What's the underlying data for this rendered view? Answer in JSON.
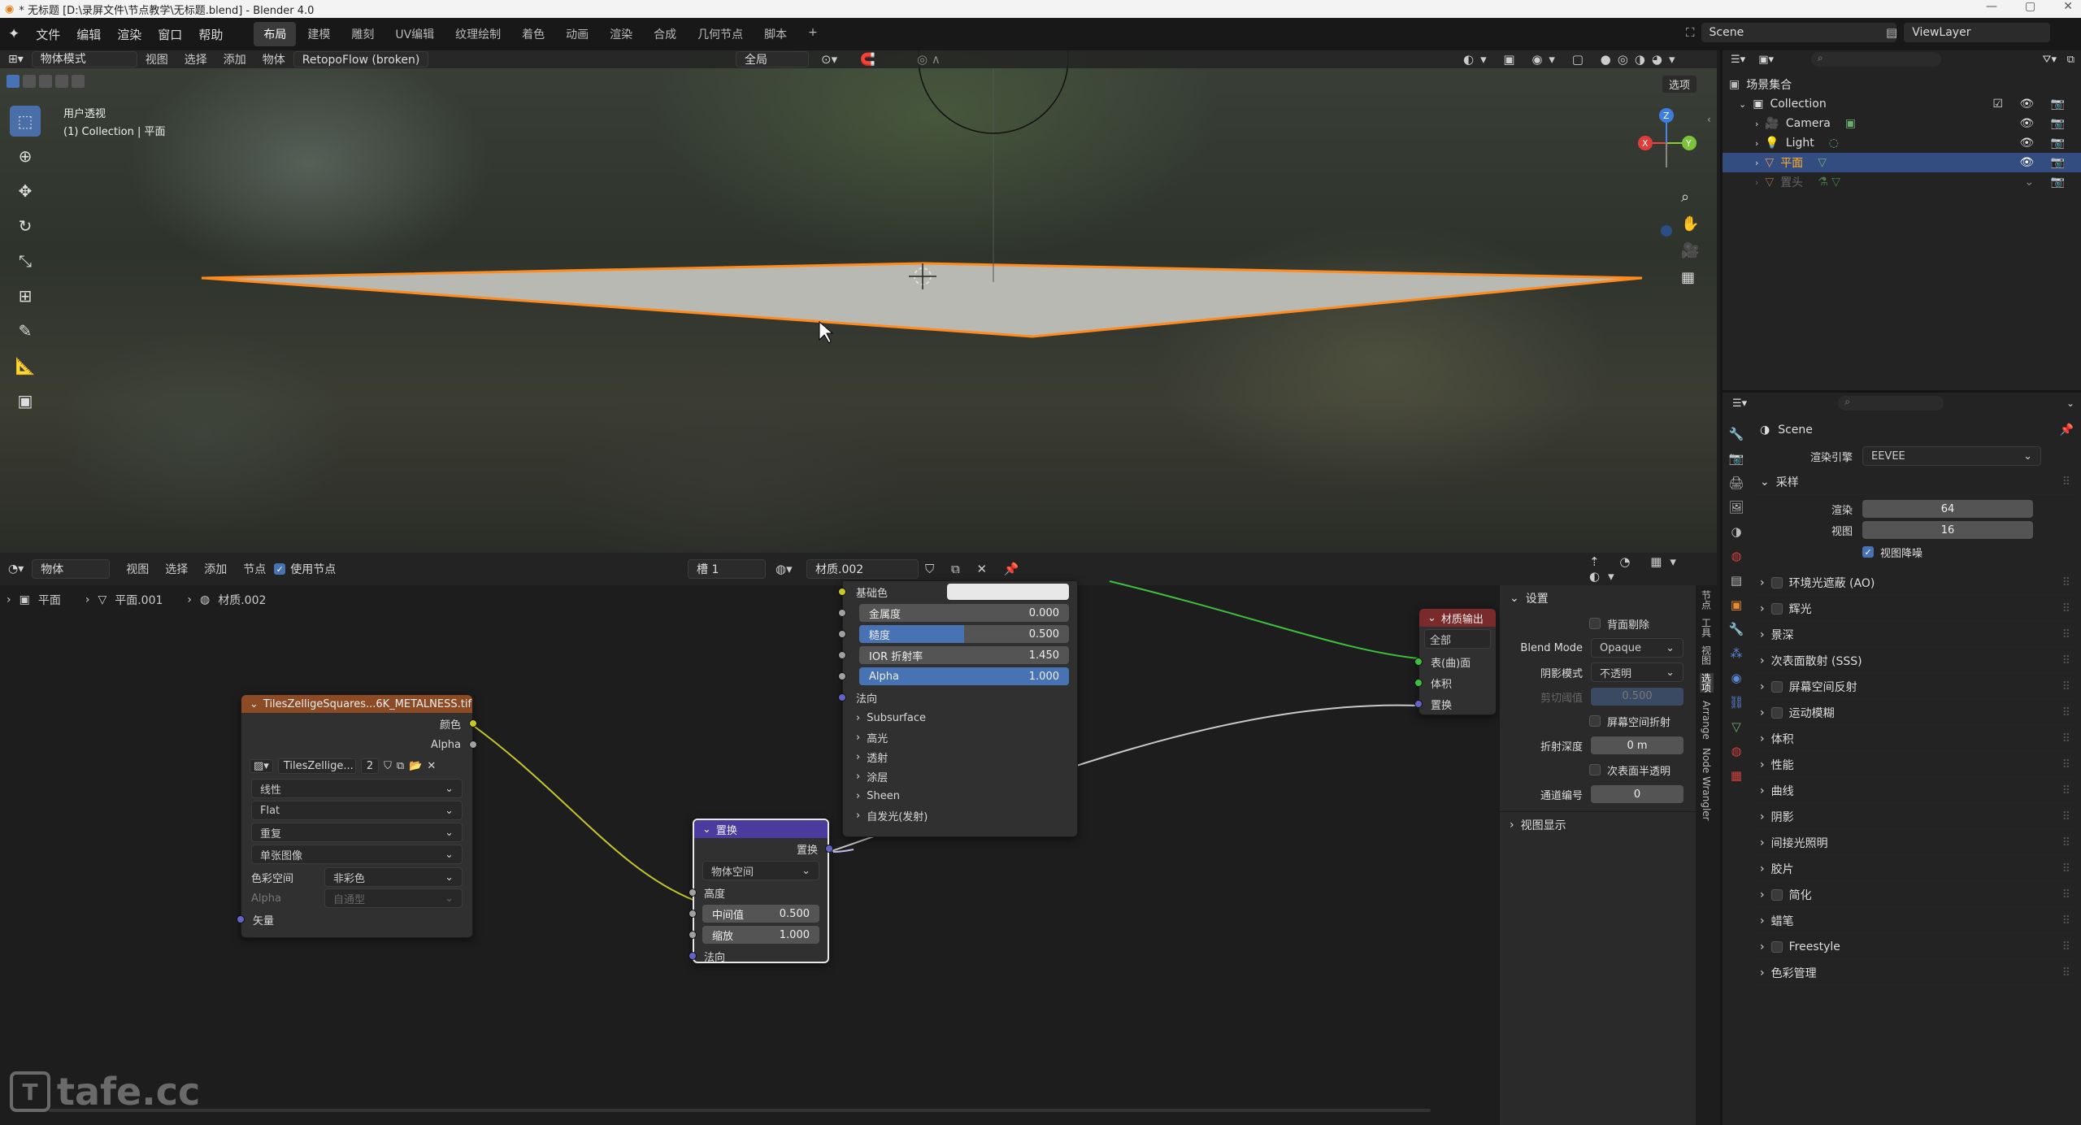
{
  "window": {
    "title": "* 无标题 [D:\\录屏文件\\节点教学\\无标题.blend] - Blender 4.0"
  },
  "menu": {
    "items": [
      "文件",
      "编辑",
      "渲染",
      "窗口",
      "帮助"
    ]
  },
  "workspaces": [
    "布局",
    "建模",
    "雕刻",
    "UV编辑",
    "纹理绘制",
    "着色",
    "动画",
    "渲染",
    "合成",
    "几何节点",
    "脚本"
  ],
  "workspace_active": "布局",
  "scene": {
    "label": "Scene",
    "viewlayer": "ViewLayer"
  },
  "viewport": {
    "mode": "物体模式",
    "menus": [
      "视图",
      "选择",
      "添加",
      "物体"
    ],
    "addon": "RetopoFlow (broken)",
    "transform": "全局",
    "options": "选项",
    "overlay_title": "用户透视",
    "overlay_sub": "(1) Collection | 平面"
  },
  "node_editor": {
    "mode": "物体",
    "menus": [
      "视图",
      "选择",
      "添加",
      "节点"
    ],
    "use_nodes": "使用节点",
    "slot": "槽 1",
    "material": "材质.002",
    "breadcrumb": [
      "平面",
      "平面.001",
      "材质.002"
    ]
  },
  "image_node": {
    "title": "TilesZelligeSquares...6K_METALNESS.tif",
    "outputs": [
      "颜色",
      "Alpha"
    ],
    "image_name": "TilesZellige...",
    "users": "2",
    "interpolation": "线性",
    "projection": "Flat",
    "extension": "重复",
    "source": "单张图像",
    "colorspace_label": "色彩空间",
    "colorspace": "非彩色",
    "alpha_label": "Alpha",
    "alpha_value": "自通型",
    "vector": "矢量"
  },
  "disp_node": {
    "title": "置换",
    "output": "置换",
    "space": "物体空间",
    "height": "高度",
    "midlevel_label": "中间值",
    "midlevel": "0.500",
    "scale_label": "缩放",
    "scale": "1.000",
    "normal": "法向"
  },
  "bsdf_node": {
    "base_color": "基础色",
    "metallic_label": "金属度",
    "metallic": "0.000",
    "roughness_label": "糙度",
    "roughness": "0.500",
    "roughness_fill": 0.5,
    "ior_label": "IOR 折射率",
    "ior": "1.450",
    "alpha_label": "Alpha",
    "alpha": "1.000",
    "alpha_fill": 1.0,
    "normal": "法向",
    "panels": [
      "Subsurface",
      "高光",
      "透射",
      "涂层",
      "Sheen",
      "自发光(发射)"
    ]
  },
  "output_node": {
    "title": "材质输出",
    "target": "全部",
    "inputs": [
      "表(曲)面",
      "体积",
      "置换"
    ]
  },
  "node_sidebar": {
    "header": "设置",
    "backface": "背面剔除",
    "blend_label": "Blend Mode",
    "blend": "Opaque",
    "shadow_label": "阴影模式",
    "shadow": "不透明",
    "clip_label": "剪切阈值",
    "clip": "0.500",
    "ssr": "屏幕空间折射",
    "refr_label": "折射深度",
    "refr": "0 m",
    "sss": "次表面半透明",
    "pass_label": "通道编号",
    "pass": "0",
    "viewport_display": "视图显示",
    "tabs": [
      "节点",
      "工具",
      "视图",
      "选项",
      "Arrange",
      "Node Wrangler"
    ]
  },
  "outliner": {
    "root": "场景集合",
    "items": [
      {
        "name": "Collection",
        "level": 1
      },
      {
        "name": "Camera",
        "level": 2
      },
      {
        "name": "Light",
        "level": 2
      },
      {
        "name": "平面",
        "level": 2,
        "selected": true
      },
      {
        "name": "置头",
        "level": 2,
        "dim": true
      }
    ]
  },
  "properties": {
    "scene": "Scene",
    "engine_label": "渲染引擎",
    "engine": "EEVEE",
    "sampling": "采样",
    "render_label": "渲染",
    "render": "64",
    "viewport_label": "视图",
    "viewport": "16",
    "denoise": "视图降噪",
    "sections": [
      "环境光遮蔽 (AO)",
      "辉光",
      "景深",
      "次表面散射 (SSS)",
      "屏幕空间反射",
      "运动模糊",
      "体积",
      "性能",
      "曲线",
      "阴影",
      "间接光照明",
      "胶片",
      "简化",
      "蜡笔",
      "Freestyle",
      "色彩管理"
    ],
    "section_checks": [
      true,
      true,
      false,
      false,
      true,
      true,
      false,
      false,
      false,
      false,
      false,
      false,
      true,
      false,
      true,
      false
    ]
  },
  "watermark": "tafe.cc",
  "colors": {
    "accent": "#4772b3",
    "selection": "#ff8a1e",
    "link_green": "#3fbf3f",
    "link_yellow": "#c7c729"
  }
}
